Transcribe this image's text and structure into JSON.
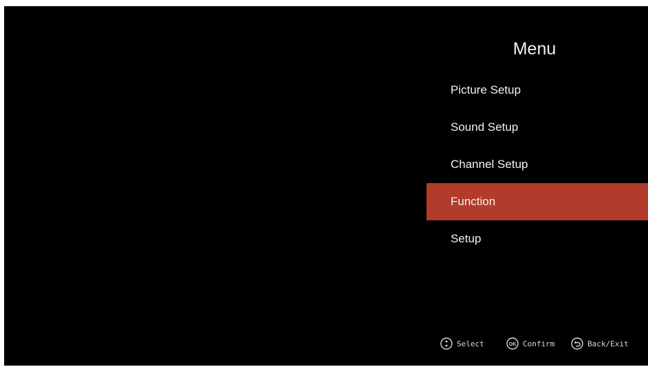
{
  "menu": {
    "title": "Menu",
    "items": [
      {
        "label": "Picture Setup",
        "selected": false
      },
      {
        "label": "Sound Setup",
        "selected": false
      },
      {
        "label": "Channel Setup",
        "selected": false
      },
      {
        "label": "Function",
        "selected": true
      },
      {
        "label": "Setup",
        "selected": false
      }
    ]
  },
  "hints": {
    "select": "Select",
    "confirm": "Confirm",
    "back": "Back/Exit",
    "ok_glyph": "OK"
  },
  "colors": {
    "background": "#000000",
    "highlight": "#b23b2c",
    "text": "#f2f2f2"
  },
  "icons": {
    "select": "dpad-icon",
    "confirm": "ok-button-icon",
    "back": "back-arrow-icon"
  }
}
